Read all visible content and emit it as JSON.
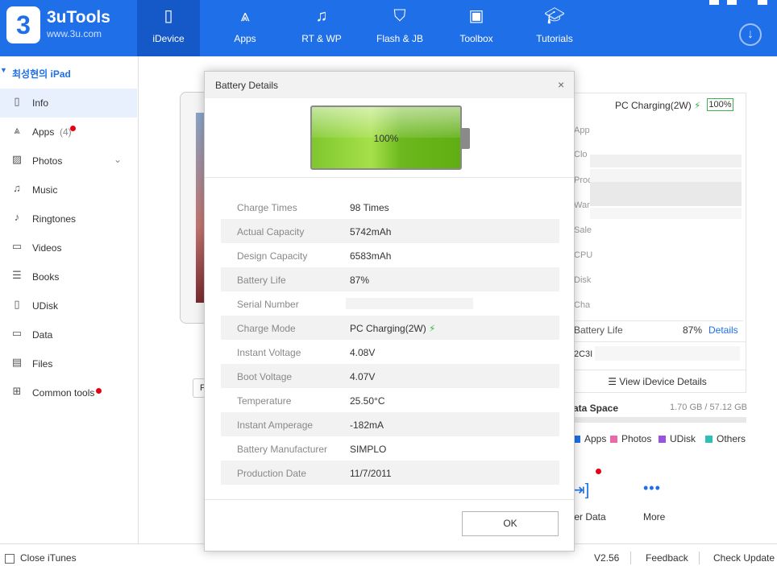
{
  "app": {
    "brand": "3uTools",
    "site": "www.3u.com",
    "logo": "3"
  },
  "nav": [
    {
      "label": "iDevice",
      "icon": "phone-icon"
    },
    {
      "label": "Apps",
      "icon": "app-store-icon"
    },
    {
      "label": "RT & WP",
      "icon": "music-note-icon"
    },
    {
      "label": "Flash & JB",
      "icon": "shield-icon"
    },
    {
      "label": "Toolbox",
      "icon": "toolbox-icon"
    },
    {
      "label": "Tutorials",
      "icon": "graduation-cap-icon"
    }
  ],
  "sidebar": {
    "device": "최성현의 iPad",
    "items": [
      {
        "label": "Info",
        "icon": "info-icon"
      },
      {
        "label": "Apps",
        "count": "(4)",
        "icon": "apps-icon",
        "badge": true
      },
      {
        "label": "Photos",
        "icon": "photos-icon"
      },
      {
        "label": "Music",
        "icon": "music-icon"
      },
      {
        "label": "Ringtones",
        "icon": "bell-icon"
      },
      {
        "label": "Videos",
        "icon": "video-icon"
      },
      {
        "label": "Books",
        "icon": "books-icon"
      },
      {
        "label": "UDisk",
        "icon": "udisk-icon"
      },
      {
        "label": "Data",
        "icon": "folder-icon"
      },
      {
        "label": "Files",
        "icon": "files-icon"
      },
      {
        "label": "Common tools",
        "icon": "grid-icon",
        "badge": true
      }
    ]
  },
  "info_panel": {
    "charging": "PC Charging(2W)",
    "percent": "100%",
    "row_labels": [
      "App",
      "Clo",
      "Prod",
      "War",
      "Sale",
      "CPU",
      "Disk",
      "Cha"
    ],
    "battery_life_label": "Battery Life",
    "battery_life_value": "87%",
    "details_link": "Details",
    "serial_partial": "2C3I",
    "view_details": "View iDevice Details",
    "data_space_label": "ata Space",
    "data_space_value": "1.70 GB / 57.12 GB",
    "legend": [
      {
        "label": "Apps",
        "color": "#1f6fe8"
      },
      {
        "label": "Photos",
        "color": "#e86aa9"
      },
      {
        "label": "UDisk",
        "color": "#9a52e0"
      },
      {
        "label": "Others",
        "color": "#2fbfb5"
      }
    ],
    "tools": [
      {
        "label": "fer Data",
        "icon": "transfer-icon"
      },
      {
        "label": "More",
        "icon": "more-icon"
      }
    ],
    "partial_button": "F"
  },
  "footer": {
    "close_itunes": "Close iTunes",
    "version": "V2.56",
    "feedback": "Feedback",
    "check_update": "Check Update"
  },
  "dialog": {
    "title": "Battery Details",
    "battery_percent": "100%",
    "battery_level": 1.0,
    "rows": [
      {
        "label": "Charge Times",
        "value": "98 Times"
      },
      {
        "label": "Actual Capacity",
        "value": "5742mAh"
      },
      {
        "label": "Design Capacity",
        "value": "6583mAh"
      },
      {
        "label": "Battery Life",
        "value": "87%"
      },
      {
        "label": "Serial Number",
        "value": ""
      },
      {
        "label": "Charge Mode",
        "value": "PC Charging(2W)"
      },
      {
        "label": "Instant Voltage",
        "value": "4.08V"
      },
      {
        "label": "Boot Voltage",
        "value": "4.07V"
      },
      {
        "label": "Temperature",
        "value": "25.50°C"
      },
      {
        "label": "Instant Amperage",
        "value": "-182mA"
      },
      {
        "label": "Battery Manufacturer",
        "value": "SIMPLO"
      },
      {
        "label": "Production Date",
        "value": "11/7/2011"
      }
    ],
    "ok": "OK"
  }
}
